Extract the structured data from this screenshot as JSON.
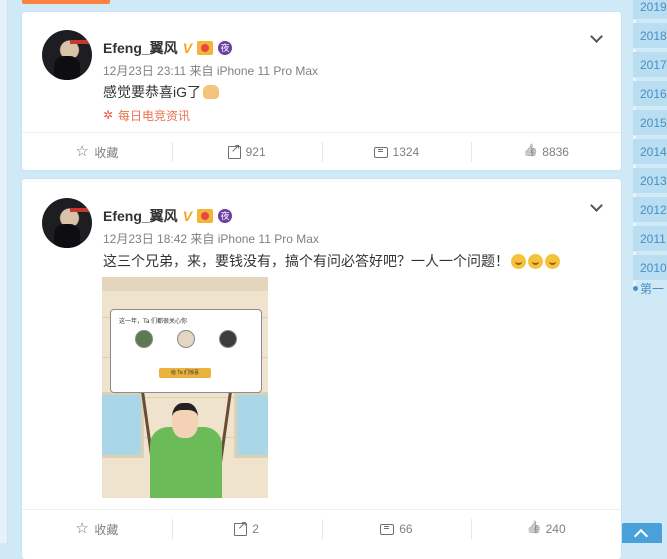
{
  "posts": [
    {
      "author": "Efeng_翼风",
      "night_badge": "夜",
      "meta": "12月23日 23:11 来自 iPhone 11 Pro Max",
      "text": "感觉要恭喜iG了",
      "source_label": "每日电竞资讯",
      "actions": {
        "favorite": "收藏",
        "repost": "921",
        "comment": "1324",
        "like": "8836"
      }
    },
    {
      "author": "Efeng_翼风",
      "night_badge": "夜",
      "meta": "12月23日 18:42 来自 iPhone 11 Pro Max",
      "text": "这三个兄弟，来，要钱没有，搞个有问必答好吧？一人一个问题！",
      "actions": {
        "favorite": "收藏",
        "repost": "2",
        "comment": "66",
        "like": "240"
      }
    }
  ],
  "image": {
    "popup_title": "这一年，Ta 们都很关心你",
    "popup_button": "给 Ta 们惊喜"
  },
  "year_nav": {
    "years": [
      "2019",
      "2018",
      "2017",
      "2016",
      "2015",
      "2014",
      "2013",
      "2012",
      "2011",
      "2010"
    ],
    "first_label": "第一"
  },
  "colors": {
    "background": "#cfe9f7",
    "source_color": "#eb7350",
    "year_text": "#4a8fc3"
  }
}
